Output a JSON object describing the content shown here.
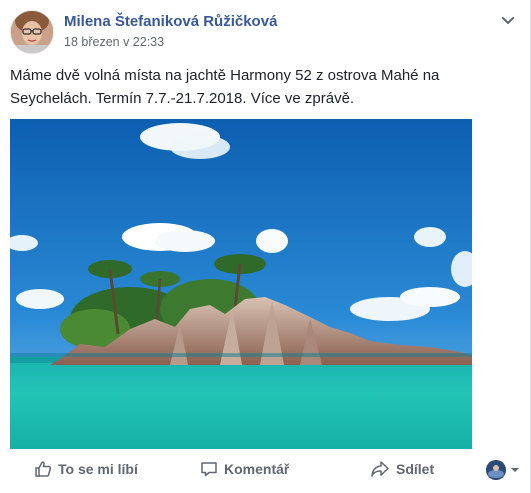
{
  "post": {
    "author": "Milena Štefaniková Růžičková",
    "timestamp": "18 březen v 22:33",
    "text": "Máme dvě volná místa na jachtě Harmony 52 z ostrova Mahé na Seychelách. Termín 7.7.-21.7.2018. Více ve zprávě."
  },
  "actions": {
    "like_label": "To se mi líbí",
    "comment_label": "Komentář",
    "share_label": "Sdílet"
  },
  "icons": {
    "like": "thumbs-up-icon",
    "comment": "speech-bubble-icon",
    "share": "share-arrow-icon",
    "menu": "chevron-down-icon",
    "audience": "avatar-dropdown-icon"
  },
  "colors": {
    "author": "#385898",
    "secondary_text": "#616770",
    "body_text": "#1d2129"
  }
}
